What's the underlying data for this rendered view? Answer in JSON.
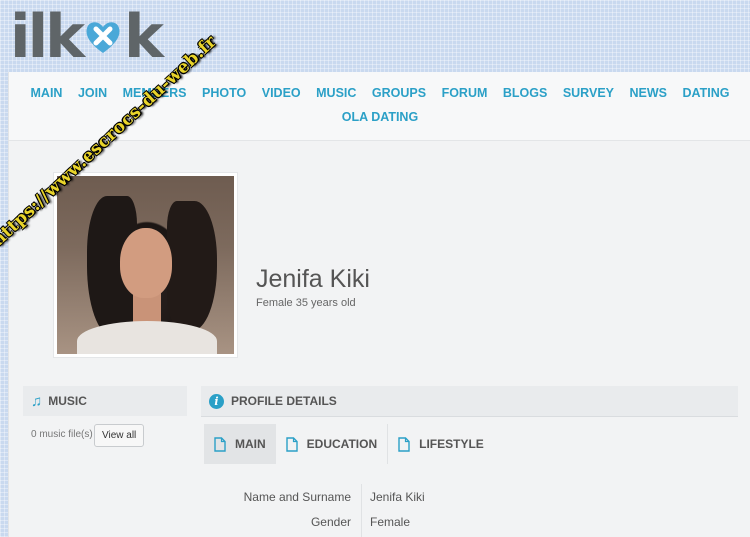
{
  "logo": {
    "text_left": "ilk",
    "text_right": "k"
  },
  "nav": {
    "row1": [
      "MAIN",
      "JOIN",
      "MEMBERS",
      "PHOTO",
      "VIDEO",
      "MUSIC",
      "GROUPS",
      "FORUM",
      "BLOGS",
      "SURVEY",
      "NEWS",
      "DATING"
    ],
    "row2": [
      "OLA DATING"
    ]
  },
  "watermark": "https://www.escrocs-du-web.fr",
  "profile": {
    "name": "Jenifa Kiki",
    "subtitle": "Female 35 years old"
  },
  "music": {
    "title": "MUSIC",
    "count": "0 music file(s)",
    "view_all": "View all"
  },
  "details": {
    "title": "PROFILE DETAILS",
    "tabs": [
      "MAIN",
      "EDUCATION",
      "LIFESTYLE"
    ],
    "fields": [
      {
        "label": "Name and Surname",
        "value": "Jenifa Kiki"
      },
      {
        "label": "Gender",
        "value": "Female"
      }
    ]
  },
  "colors": {
    "accent": "#2ba0c7",
    "logo": "#5f6568",
    "heart": "#4aa8d8"
  }
}
